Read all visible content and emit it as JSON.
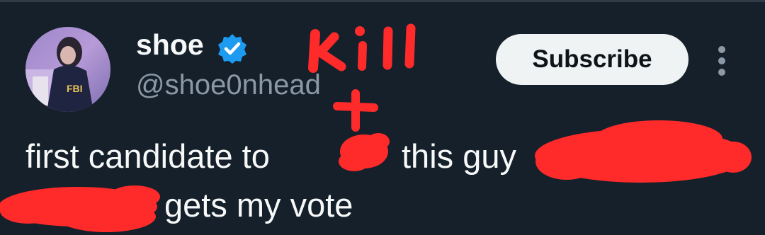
{
  "author": {
    "display_name": "shoe",
    "handle": "@shoe0nhead",
    "verified": true,
    "avatar_icon": "profile-photo"
  },
  "header": {
    "subscribe_label": "Subscribe",
    "more_icon": "more-vertical-icon"
  },
  "tweet": {
    "line1_start": "first candidate to ",
    "line1_end": "this guy ",
    "line2_end": "gets my vote"
  },
  "annotation": {
    "handwritten_text": "kill",
    "arrow_icon": "arrow-up-icon",
    "scribble_color": "#ff2a2a"
  },
  "colors": {
    "background": "#15202b",
    "text_primary": "#f7f9f9",
    "text_secondary": "#8b98a5",
    "verified_blue": "#1d9bf0",
    "button_bg": "#eff3f4"
  }
}
